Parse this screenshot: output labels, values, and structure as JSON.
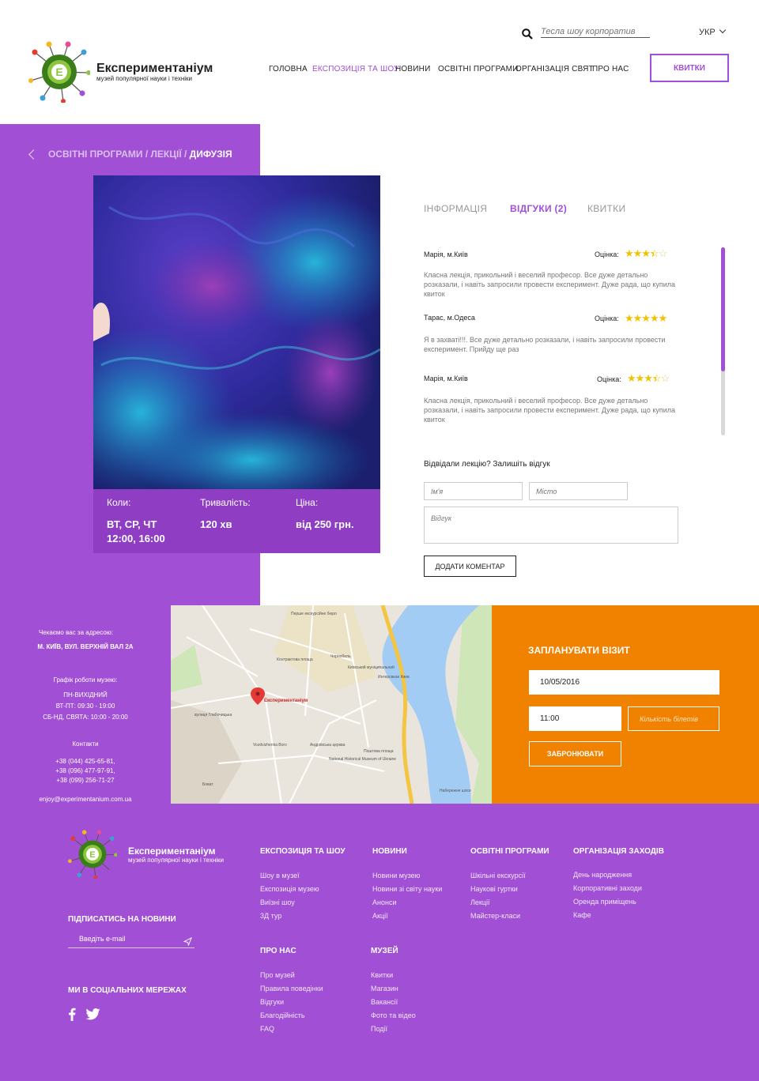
{
  "header": {
    "logo_title": "Експериментаніум",
    "logo_subtitle": "музей популярної науки і техніки",
    "logo_letter": "E",
    "search_placeholder": "Тесла шоу корпоратив",
    "language": "УКР",
    "nav": [
      "ГОЛОВНА",
      "ЕКСПОЗИЦІЯ ТА ШОУ",
      "НОВИНИ",
      "ОСВІТНІ ПРОГРАМИ",
      "ОРГАНІЗАЦІЯ СВЯТ",
      "ПРО НАС"
    ],
    "tickets_button": "КВИТКИ"
  },
  "breadcrumb": {
    "trail": "ОСВІТНІ ПРОГРАМИ / ЛЕКЦІЇ / ",
    "current": "ДИФУЗІЯ"
  },
  "event": {
    "when_label": "Коли:",
    "when_value": "ВТ, СР, ЧТ\n12:00, 16:00",
    "duration_label": "Тривалість:",
    "duration_value": "120 хв",
    "price_label": "Ціна:",
    "price_value": "від 250 грн."
  },
  "tabs": [
    "ІНФОРМАЦІЯ",
    "ВІДГУКИ (2)",
    "КВИТКИ"
  ],
  "reviews_section": {
    "rating_label": "Оцінка:",
    "items": [
      {
        "author": "Марія, м.Київ",
        "rating": 3.5,
        "text": "Класна лекція, прикольний і веселий професор. Все дуже детально розказали, і навіть запросили провести експеримент. Дуже рада, що купила квиток"
      },
      {
        "author": "Тарас,  м.Одеса",
        "rating": 5,
        "text": "Я в захваті!!!. Все дуже детально розказали, і навіть запросили провести експеримент. Прийду ще раз"
      },
      {
        "author": "Марія, м.Київ",
        "rating": 3.5,
        "text": "Класна лекція, прикольний і веселий професор. Все дуже детально розказали, і навіть запросили провести експеримент. Дуже рада, що купила квиток"
      }
    ]
  },
  "review_form": {
    "question": "Відвідали лекцію? Залишіть відгук",
    "name_placeholder": "Ім'я",
    "city_placeholder": "Місто",
    "review_placeholder": "Відгук",
    "submit": "ДОДАТИ КОМЕНТАР"
  },
  "contacts": {
    "address_label": "Чекаємо вас за адресою:",
    "address": "М. КИЇВ, ВУЛ. ВЕРХНІЙ ВАЛ 2А",
    "hours_label": "Графік роботи музею:",
    "hours_1": "ПН-ВИХІДНИЙ",
    "hours_2": "ВТ-ПТ: 09:30 - 19:00",
    "hours_3": "СБ-НД, СВЯТА: 10:00 - 20:00",
    "contacts_label": "Контакти",
    "phone_1": "+38 (044) 425-65-81,",
    "phone_2": "+38 (096) 477-97-91,",
    "phone_3": "+38 (099) 256-71-27",
    "email": "enjoy@experimentanium.com.ua"
  },
  "map": {
    "marker_label": "Експериментаніум",
    "labels": [
      "Перше екскурсійне бюро",
      "Контрактова площа",
      "Чорнобиль",
      "Київський муніципальний",
      "Интерсвизи Киев",
      "Андріївська церква",
      "Поштова площа",
      "National Historical Museum of Ukraine",
      "Vozdvizhenka Boro",
      "Набережне шосе",
      "вулиця Глибочицька",
      "Боват"
    ]
  },
  "visit": {
    "title": "ЗАПЛАНУВАТИ ВІЗИТ",
    "date": "10/05/2016",
    "time": "11:00",
    "tickets_placeholder": "Кількість білетів",
    "book_button": "ЗАБРОНЮВАТИ"
  },
  "footer": {
    "logo_title": "Експериментаніум",
    "logo_subtitle": "музей популярної науки і техніки",
    "subscribe_title": "ПІДПИСАТИСЬ НА НОВИНИ",
    "email_placeholder": "Введіть e-mail",
    "social_title": "МИ В СОЦІАЛЬНИХ МЕРЕЖАХ",
    "columns": [
      {
        "title": "ЕКСПОЗИЦІЯ ТА ШОУ",
        "links": [
          "Шоу в музеї",
          "Експозиція музею",
          "Виїзні шоу",
          "3Д тур"
        ]
      },
      {
        "title": "НОВИНИ",
        "links": [
          "Новини музею",
          "Новини зі світу науки",
          "Анонси",
          "Акції"
        ]
      },
      {
        "title": "ОСВІТНІ ПРОГРАМИ",
        "links": [
          "Шкільні екскурсії",
          "Наукові гуртки",
          "Лекції",
          "Майстер-класи"
        ]
      },
      {
        "title": "ОРГАНІЗАЦІЯ ЗАХОДІВ",
        "links": [
          "День народження",
          "Корпоративні заходи",
          "Оренда приміщень",
          "Кафе"
        ]
      },
      {
        "title": "ПРО НАС",
        "links": [
          "Про музей",
          "Правила поведінки",
          "Відгуки",
          "Благодійність",
          "FAQ"
        ]
      },
      {
        "title": "МУЗЕЙ",
        "links": [
          "Квитки",
          "Магазин",
          "Вакансії",
          "Фото та відео",
          "Події"
        ]
      }
    ]
  },
  "colors": {
    "accent": "#a14fd4",
    "orange": "#f08200",
    "star": "#f2c200"
  }
}
